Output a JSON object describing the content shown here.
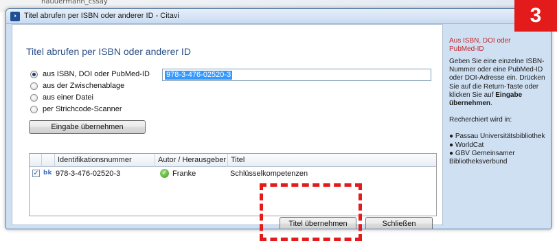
{
  "background": {
    "partial_text": "nauuermann_cssay"
  },
  "window": {
    "title": "Titel abrufen per ISBN oder anderer ID - Citavi",
    "app_icon_glyph": "›"
  },
  "dialog": {
    "heading": "Titel abrufen per ISBN oder anderer ID",
    "options": [
      {
        "label": "aus ISBN, DOI oder PubMed-ID",
        "checked": true
      },
      {
        "label": "aus der Zwischenablage",
        "checked": false
      },
      {
        "label": "aus einer Datei",
        "checked": false
      },
      {
        "label": "per Strichcode-Scanner",
        "checked": false
      }
    ],
    "id_input": {
      "value": "978-3-476-02520-3"
    },
    "apply_input_button": "Eingabe übernehmen"
  },
  "table": {
    "columns": [
      "Identifikationsnummer",
      "Autor / Herausgeber",
      "Titel"
    ],
    "rows": [
      {
        "checked": true,
        "id": "978-3-476-02520-3",
        "author": "Franke",
        "title": "Schlüsselkompetenzen"
      }
    ]
  },
  "footer": {
    "apply_title_button": "Titel übernehmen",
    "close_button": "Schließen"
  },
  "sidebar": {
    "title": "Aus ISBN, DOI oder PubMed-ID",
    "p1": "Geben Sie eine einzelne ISBN-Nummer oder eine PubMed-ID oder DOI-Adresse ein. Drücken Sie auf die Return-Taste oder klicken Sie auf",
    "p1_bold": "Eingabe übernehmen",
    "p1_end": ".",
    "p2": "Recherchiert wird in:",
    "sources": [
      "Passau Universitätsbibliothek",
      "WorldCat",
      "GBV Gemeinsamer Bibliotheksverbund"
    ]
  },
  "annotation": {
    "step_number": "3",
    "color": "#e31b1b"
  },
  "colors": {
    "heading": "#2a4f86",
    "selection": "#3399ff",
    "sidebar_bg": "#cfe0f3",
    "sidebar_title": "#c1272d"
  },
  "icons": {
    "book": "book-icon",
    "ok": "check-circle-icon"
  }
}
